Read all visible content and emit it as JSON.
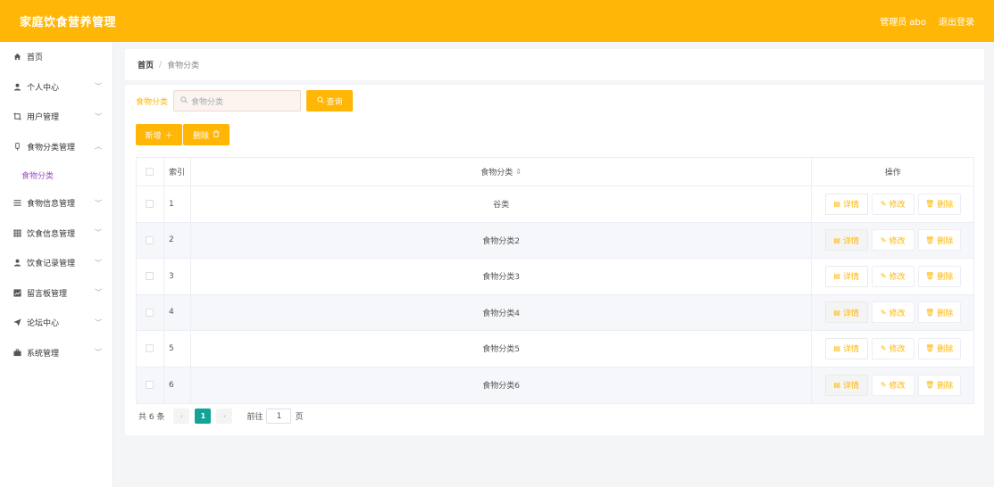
{
  "header": {
    "title": "家庭饮食营养管理",
    "user_label": "管理员 abo",
    "logout_label": "退出登录",
    "accent_color": "#ffb606"
  },
  "sidebar": {
    "items": [
      {
        "label": "首页",
        "icon": "home-icon",
        "has_children": false
      },
      {
        "label": "个人中心",
        "icon": "user-icon",
        "has_children": true
      },
      {
        "label": "用户管理",
        "icon": "crop-icon",
        "has_children": true
      },
      {
        "label": "食物分类管理",
        "icon": "bottle-icon",
        "has_children": true,
        "expanded": true
      },
      {
        "label": "食物信息管理",
        "icon": "list-icon",
        "has_children": true
      },
      {
        "label": "饮食信息管理",
        "icon": "grid-icon",
        "has_children": true
      },
      {
        "label": "饮食记录管理",
        "icon": "user-icon",
        "has_children": true
      },
      {
        "label": "留言板管理",
        "icon": "chart-icon",
        "has_children": true
      },
      {
        "label": "论坛中心",
        "icon": "send-icon",
        "has_children": true
      },
      {
        "label": "系统管理",
        "icon": "briefcase-icon",
        "has_children": true
      }
    ],
    "active_sub": "食物分类"
  },
  "breadcrumb": {
    "home": "首页",
    "separator": "/",
    "current": "食物分类"
  },
  "search": {
    "label": "食物分类",
    "placeholder": "食物分类",
    "query_label": "查询"
  },
  "actions": {
    "add_label": "新增",
    "delete_label": "删除"
  },
  "table": {
    "headers": {
      "index": "索引",
      "name": "食物分类",
      "ops": "操作"
    },
    "rows": [
      {
        "index": "1",
        "name": "谷类"
      },
      {
        "index": "2",
        "name": "食物分类2"
      },
      {
        "index": "3",
        "name": "食物分类3"
      },
      {
        "index": "4",
        "name": "食物分类4"
      },
      {
        "index": "5",
        "name": "食物分类5"
      },
      {
        "index": "6",
        "name": "食物分类6"
      }
    ],
    "op_labels": {
      "detail": "详情",
      "edit": "修改",
      "delete": "删除"
    }
  },
  "pagination": {
    "total_text": "共 6 条",
    "current_page": "1",
    "goto_prefix": "前往",
    "goto_value": "1",
    "goto_suffix": "页"
  }
}
